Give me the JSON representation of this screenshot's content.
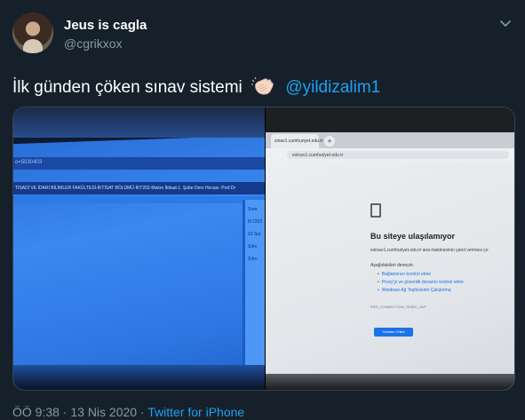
{
  "tweet": {
    "author_name": "Jeus is cagla",
    "author_handle": "@cgrikxox",
    "text": "İlk günden çöken sınav sistemi",
    "mention": "@yildizalim1",
    "timestamp": "ÖÖ 9:38 · 13 Nis 2020 · ",
    "source": "Twitter for iPhone"
  },
  "photo_left": {
    "url_fragment": "o=5030403",
    "breadcrumb": "TİSADİ VE İDARİ BİLİMLER FAKÜLTESİ-İKTİSAT BÖLÜMÜ-İKT202-Makro İktisat-1. Şube Ders Hocası: Prof.Dr",
    "side_header": "Sına",
    "side_rows": [
      "İKT202",
      "10 Sor",
      "Sıfırı",
      "Sıfırı"
    ]
  },
  "photo_right": {
    "tab_label": "sinav1.cumhuriyet.edu.tr",
    "url": "esinav1.cumhuriyet.edu.tr",
    "error_title": "Bu siteye ulaşılamıyor",
    "error_detail": "esinav1.cumhuriyet.edu.tr ana makinesinin yanıt vermesi ço",
    "try_label": "Aşağıdakileri deneyin:",
    "suggestions": [
      "Bağlantınızı kontrol etme",
      "Proxy'yi ve güvenlik duvarını kontrol etme",
      "Windows Ağ Teşhislerini Çalıştırma"
    ],
    "error_code": "ERR_CONNECTION_TIMED_OUT",
    "reload_label": "Yeniden Yükle"
  },
  "colors": {
    "background": "#15202b",
    "text_primary": "#ffffff",
    "text_secondary": "#8899a6",
    "link": "#1da1f2"
  },
  "icons": [
    "avatar",
    "chevron-down-icon",
    "clapping-hands-emoji",
    "page-error-icon"
  ]
}
